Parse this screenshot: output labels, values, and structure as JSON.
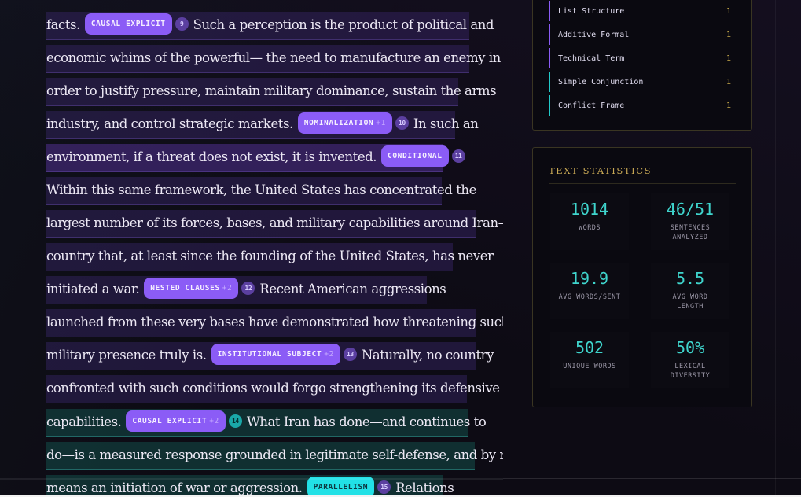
{
  "text": {
    "lines": [
      {
        "before": "facts.",
        "tag": "CAUSAL EXPLICIT",
        "plus": "",
        "num": "9",
        "after": "Such a perception is the product of political and"
      },
      {
        "text": "economic whims of the powerful— the need to manufacture an enemy in"
      },
      {
        "text": "order to justify pressure, maintain military dominance, sustain the arms"
      },
      {
        "before": "industry, and control strategic markets.",
        "tag": "NOMINALIZATION",
        "plus": "+1",
        "num": "10",
        "after": "In such an"
      },
      {
        "before": "environment, if a threat does not exist, it is invented.",
        "tag": "CONDITIONAL",
        "plus": "",
        "num": "11",
        "after": ""
      },
      {
        "text": "Within this same framework, the United States has concentrated the"
      },
      {
        "text": "largest number of its forces, bases, and military capabilities around Iran—a"
      },
      {
        "text": "country that, at least since the founding of the United States, has never"
      },
      {
        "before": "initiated a war.",
        "tag": "NESTED CLAUSES",
        "plus": "+2",
        "num": "12",
        "after": "Recent American aggressions"
      },
      {
        "text": "launched from these very bases have demonstrated how threatening such a"
      },
      {
        "before": "military presence truly is.",
        "tag": "INSTITUTIONAL SUBJECT",
        "plus": "+2",
        "num": "13",
        "after": "Naturally, no country"
      },
      {
        "text": "confronted with such conditions would forgo strengthening its defensive"
      },
      {
        "before": "capabilities.",
        "tag": "CAUSAL EXPLICIT",
        "plus": "+2",
        "num": "14",
        "after": "What Iran has done—and continues to"
      },
      {
        "text": "do—is a measured response grounded in legitimate self-defense, and by no"
      },
      {
        "before": "means an initiation of war or aggression.",
        "tag": "PARALLELISM",
        "plus": "",
        "num": "15",
        "after": "Relations"
      }
    ]
  },
  "patterns": [
    {
      "label": "List Structure",
      "count": "1"
    },
    {
      "label": "Additive Formal",
      "count": "1"
    },
    {
      "label": "Technical Term",
      "count": "1"
    },
    {
      "label": "Simple Conjunction",
      "count": "1"
    },
    {
      "label": "Conflict Frame",
      "count": "1"
    }
  ],
  "stats": {
    "title": "TEXT STATISTICS",
    "items": [
      {
        "value": "1014",
        "label": "WORDS"
      },
      {
        "value": "46/51",
        "label": "SENTENCES\nANALYZED"
      },
      {
        "value": "19.9",
        "label": "AVG WORDS/SENT"
      },
      {
        "value": "5.5",
        "label": "AVG WORD\nLENGTH"
      },
      {
        "value": "502",
        "label": "UNIQUE WORDS"
      },
      {
        "value": "50%",
        "label": "LEXICAL\nDIVERSITY"
      }
    ]
  },
  "colors": {
    "accent_purple": "#8b5cf6",
    "accent_cyan": "#22e1e6",
    "stat_value": "#3fd5cd",
    "gold": "#c9a955"
  }
}
